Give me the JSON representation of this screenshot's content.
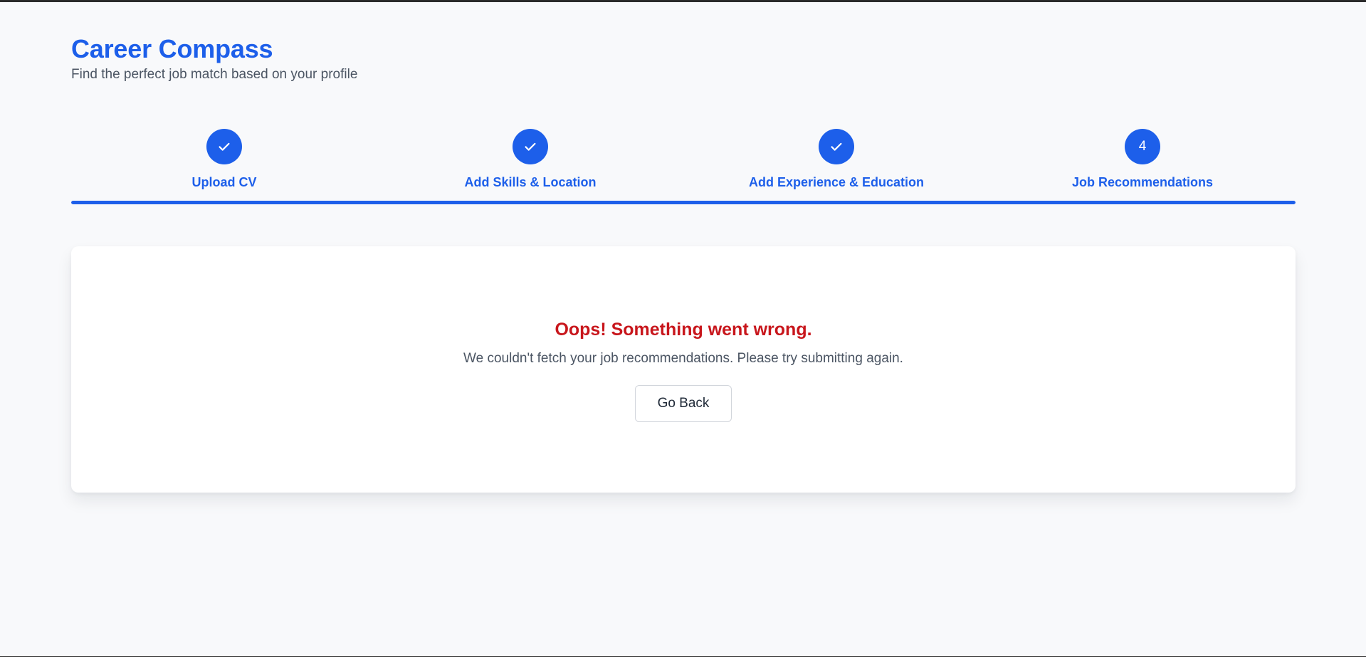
{
  "header": {
    "title": "Career Compass",
    "subtitle": "Find the perfect job match based on your profile"
  },
  "stepper": {
    "progress_fraction": 1.0,
    "steps": [
      {
        "label": "Upload CV",
        "state": "completed",
        "icon": "check-icon"
      },
      {
        "label": "Add Skills & Location",
        "state": "completed",
        "icon": "check-icon"
      },
      {
        "label": "Add Experience & Education",
        "state": "completed",
        "icon": "check-icon"
      },
      {
        "label": "Job Recommendations",
        "state": "current",
        "number": "4"
      }
    ]
  },
  "error": {
    "title": "Oops! Something went wrong.",
    "message": "We couldn't fetch your job recommendations. Please try submitting again.",
    "button_label": "Go Back"
  },
  "colors": {
    "brand": "#1d5fea",
    "error": "#c8161c",
    "muted_text": "#4b5563",
    "background": "#f8f9fb"
  }
}
